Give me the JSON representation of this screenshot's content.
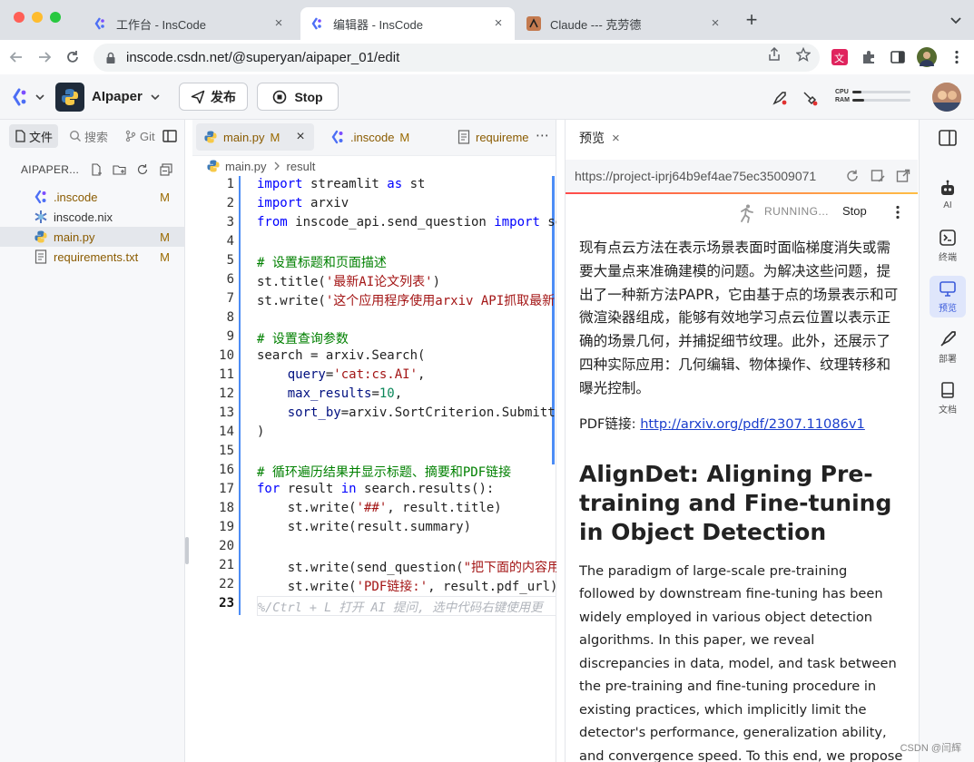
{
  "browser": {
    "tabs": [
      {
        "title": "工作台 - InsCode"
      },
      {
        "title": "编辑器 - InsCode"
      },
      {
        "title": "Claude --- 克劳德"
      }
    ],
    "new_tab_symbol": "+",
    "url": "inscode.csdn.net/@superyan/aipaper_01/edit"
  },
  "app": {
    "project_name": "AIpaper",
    "publish_label": "发布",
    "stop_label": "Stop",
    "cpu_label": "CPU",
    "ram_label": "RAM",
    "cpu_fraction": 0.15,
    "ram_fraction": 0.2
  },
  "file_panel": {
    "tabs": [
      {
        "label": "文件"
      },
      {
        "label": "搜索"
      },
      {
        "label": "Git"
      }
    ],
    "project_header": "AIPAPER...",
    "files": [
      {
        "name": ".inscode",
        "status": "M",
        "icon": "inscode-icon"
      },
      {
        "name": "inscode.nix",
        "status": "",
        "icon": "nix-icon"
      },
      {
        "name": "main.py",
        "status": "M",
        "icon": "python-icon"
      },
      {
        "name": "requirements.txt",
        "status": "M",
        "icon": "text-file-icon"
      }
    ]
  },
  "editor": {
    "tabs": [
      {
        "label": "main.py",
        "status": "M"
      },
      {
        "label": ".inscode",
        "status": "M"
      },
      {
        "label": "requireme",
        "status": ""
      }
    ],
    "breadcrumb": {
      "file": "main.py",
      "symbol": "result"
    },
    "line_numbers": [
      "1",
      "2",
      "3",
      "4",
      "5",
      "6",
      "7",
      "8",
      "9",
      "10",
      "11",
      "12",
      "13",
      "14",
      "15",
      "16",
      "17",
      "18",
      "19",
      "20",
      "21",
      "22",
      "23"
    ],
    "code": {
      "l1_kw": "import",
      "l1_rest": " streamlit ",
      "l1_kw2": "as",
      "l1_rest2": " st",
      "l2_kw": "import",
      "l2_rest": " arxiv",
      "l3_kw": "from",
      "l3_rest": " inscode_api.send_question ",
      "l3_kw2": "import",
      "l3_rest2": " se",
      "l5": "# 设置标题和页面描述",
      "l6_a": "st.title(",
      "l6_s": "'最新AI论文列表'",
      "l6_b": ")",
      "l7_a": "st.write(",
      "l7_s": "'这个应用程序使用arxiv API抓取最新",
      "l9": "# 设置查询参数",
      "l10": "search = arxiv.Search(",
      "l11_p": "    query",
      "l11_eq": "=",
      "l11_s": "'cat:cs.AI'",
      "l11_c": ",",
      "l12_p": "    max_results",
      "l12_eq": "=",
      "l12_n": "10",
      "l12_c": ",",
      "l13_p": "    sort_by",
      "l13_rest": "=arxiv.SortCriterion.Submitt",
      "l14": ")",
      "l16": "# 循环遍历结果并显示标题、摘要和PDF链接",
      "l17_kw": "for",
      "l17_a": " result ",
      "l17_kw2": "in",
      "l17_b": " search.results():",
      "l18_a": "    st.write(",
      "l18_s": "'##'",
      "l18_b": ", result.title)",
      "l19": "    st.write(result.summary)",
      "l21_a": "    st.write(send_question(",
      "l21_s": "\"把下面的内容用",
      "l22_a": "    st.write(",
      "l22_s": "'PDF链接:'",
      "l22_b": ", result.pdf_url)",
      "l23": "%/Ctrl + L 打开 AI 提问, 选中代码右键使用更"
    }
  },
  "preview": {
    "title": "预览",
    "url": "https://project-iprj64b9ef4ae75ec35009071",
    "running_label": "RUNNING...",
    "stop_label": "Stop",
    "zh_summary": "现有点云方法在表示场景表面时面临梯度消失或需要大量点来准确建模的问题。为解决这些问题，提出了一种新方法PAPR，它由基于点的场景表示和可微渲染器组成，能够有效地学习点云位置以表示正确的场景几何，并捕捉细节纹理。此外，还展示了四种实际应用：几何编辑、物体操作、纹理转移和曝光控制。",
    "pdf_label": "PDF链接: ",
    "pdf_url": "http://arxiv.org/pdf/2307.11086v1",
    "paper_title": "AlignDet: Aligning Pre-training and Fine-tuning in Object Detection",
    "en_summary": "The paradigm of large-scale pre-training followed by downstream fine-tuning has been widely employed in various object detection algorithms. In this paper, we reveal discrepancies in data, model, and task between the pre-training and fine-tuning procedure in existing practices, which implicitly limit the detector's performance, generalization ability, and convergence speed. To this end, we propose"
  },
  "right_sidebar": {
    "items": [
      {
        "label": "AI"
      },
      {
        "label": "终端"
      },
      {
        "label": "预览"
      },
      {
        "label": "部署"
      },
      {
        "label": "文档"
      }
    ]
  },
  "watermark": "CSDN @闫辉",
  "colors": {
    "accent": "#3b5bdb",
    "modified": "#9a6a00",
    "keyword": "#0000ff",
    "string": "#a31515",
    "comment": "#008000"
  }
}
